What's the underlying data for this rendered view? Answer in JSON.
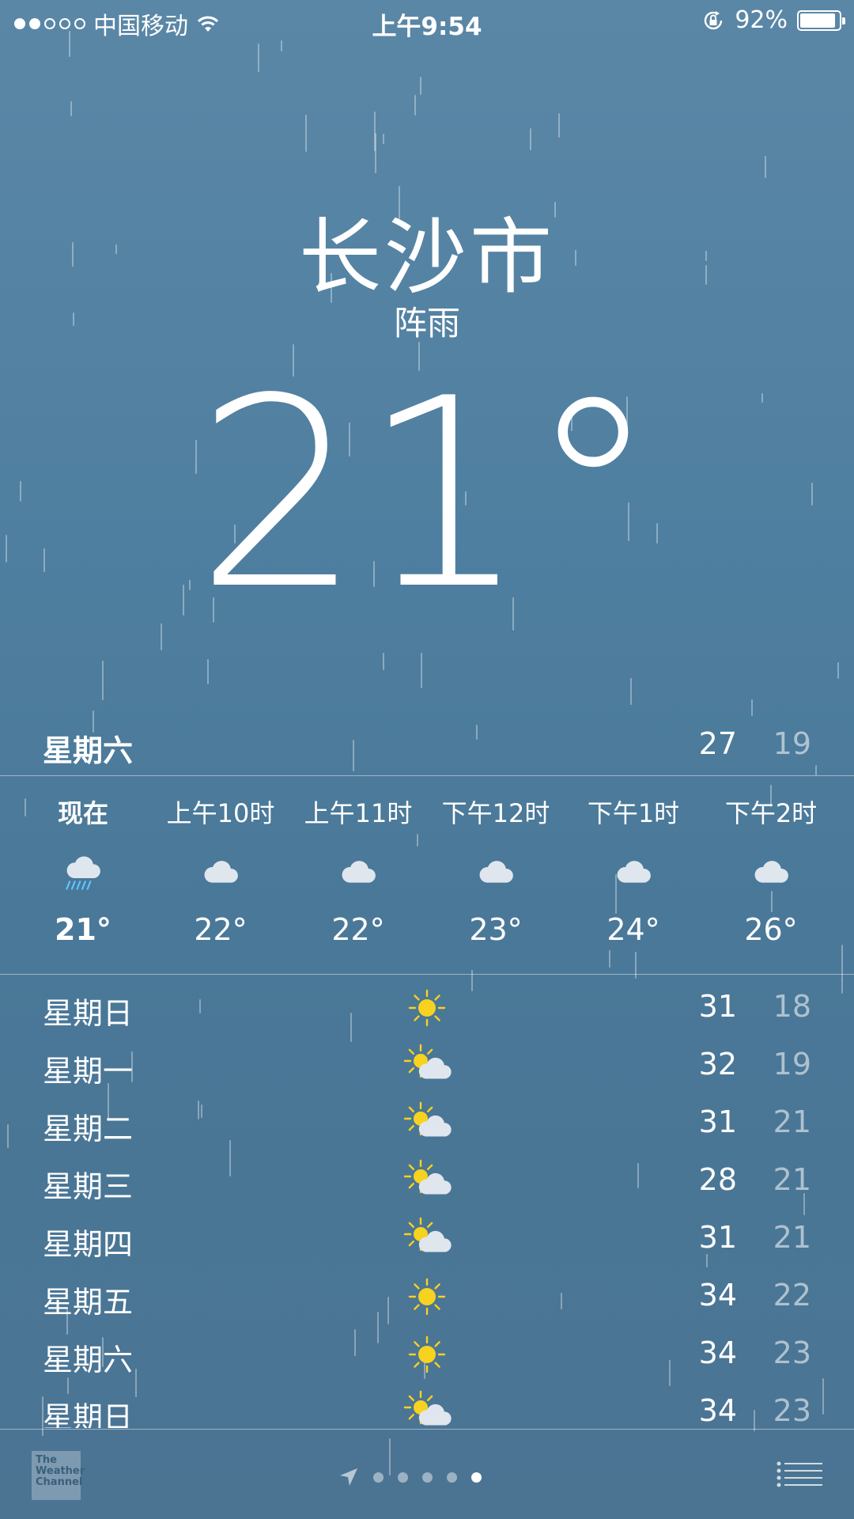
{
  "status_bar": {
    "carrier": "中国移动",
    "time": "上午9:54",
    "battery": "92%",
    "battery_level": 0.92
  },
  "location": {
    "city": "长沙市",
    "condition": "阵雨",
    "temperature": "21°"
  },
  "today": {
    "day": "星期六",
    "high": "27",
    "low": "19"
  },
  "hourly": [
    {
      "label": "现在",
      "icon": "rain-cloud-icon",
      "temp": "21°"
    },
    {
      "label": "上午10时",
      "icon": "cloud-icon",
      "temp": "22°"
    },
    {
      "label": "上午11时",
      "icon": "cloud-icon",
      "temp": "22°"
    },
    {
      "label": "下午12时",
      "icon": "cloud-icon",
      "temp": "23°"
    },
    {
      "label": "下午1时",
      "icon": "cloud-icon",
      "temp": "24°"
    },
    {
      "label": "下午2时",
      "icon": "cloud-icon",
      "temp": "26°"
    }
  ],
  "daily": [
    {
      "day": "星期日",
      "icon": "sun-icon",
      "high": "31",
      "low": "18"
    },
    {
      "day": "星期一",
      "icon": "partly-cloudy-icon",
      "high": "32",
      "low": "19"
    },
    {
      "day": "星期二",
      "icon": "partly-cloudy-icon",
      "high": "31",
      "low": "21"
    },
    {
      "day": "星期三",
      "icon": "partly-cloudy-icon",
      "high": "28",
      "low": "21"
    },
    {
      "day": "星期四",
      "icon": "partly-cloudy-icon",
      "high": "31",
      "low": "21"
    },
    {
      "day": "星期五",
      "icon": "sun-icon",
      "high": "34",
      "low": "22"
    },
    {
      "day": "星期六",
      "icon": "sun-icon",
      "high": "34",
      "low": "23"
    },
    {
      "day": "星期日",
      "icon": "partly-cloudy-icon",
      "high": "34",
      "low": "23"
    }
  ],
  "bottom_bar": {
    "logo_text": "The Weather Channel",
    "page_count": 5,
    "active_page": 4
  },
  "colors": {
    "sun": "#f7d21e",
    "cloud": "#dfe6ee",
    "rain": "#5fc3ff"
  }
}
